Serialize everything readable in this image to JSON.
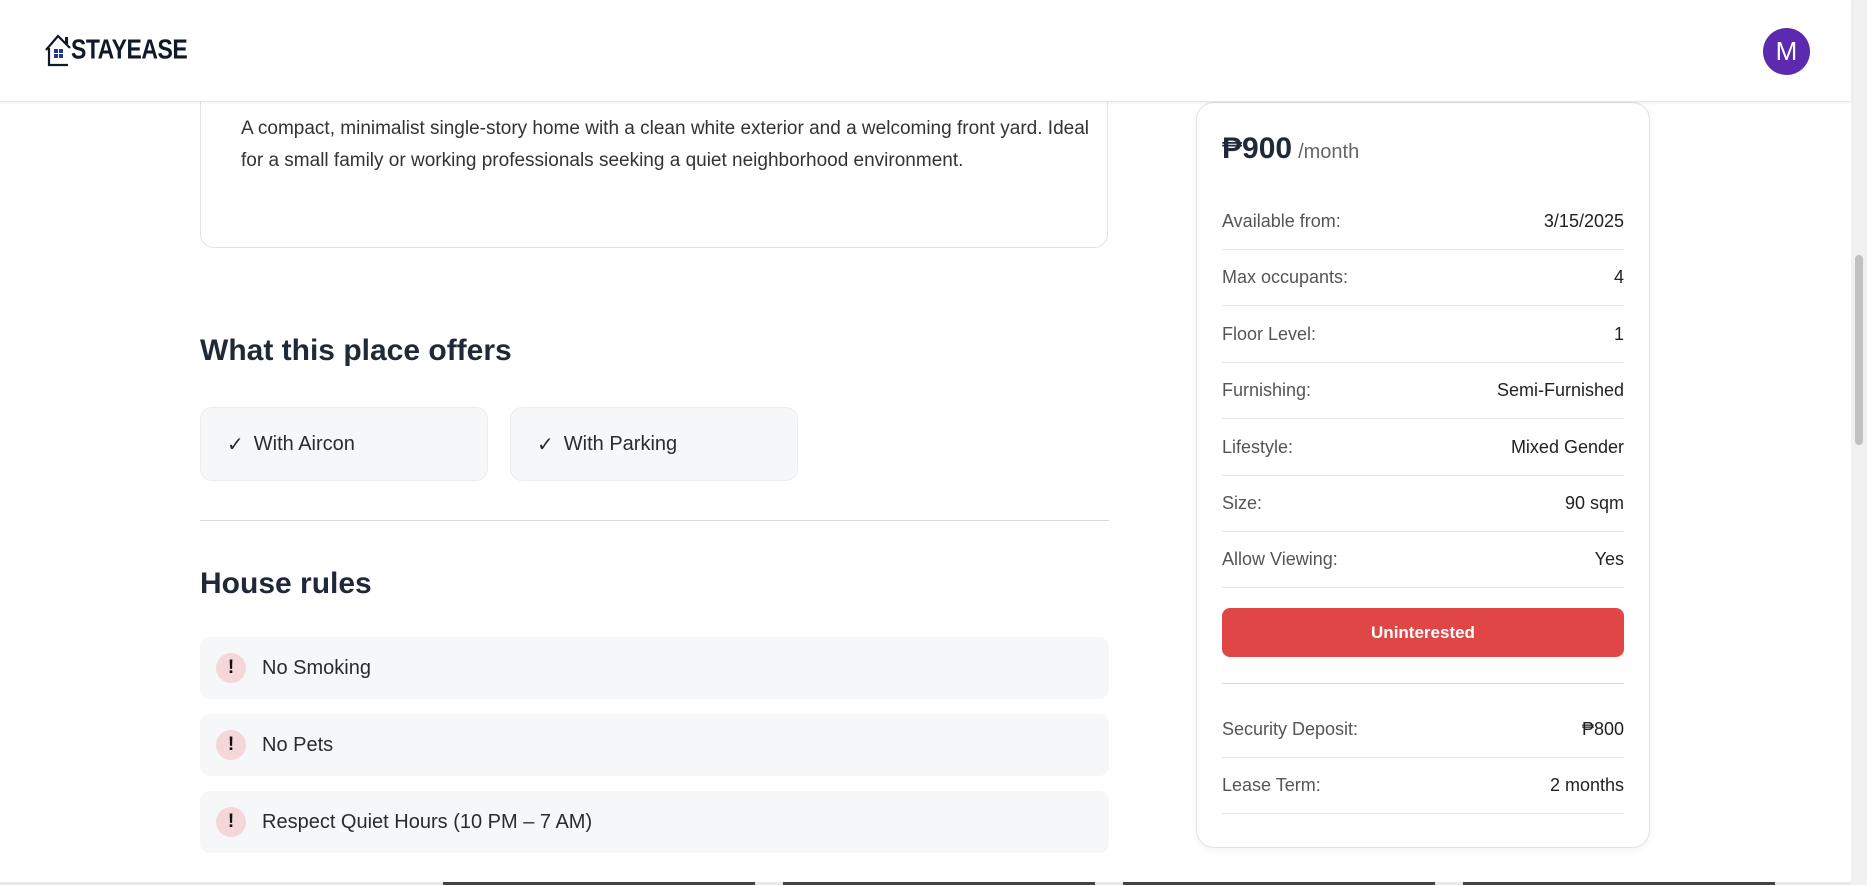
{
  "header": {
    "logo_text": "STAYEASE",
    "avatar_initial": "M"
  },
  "description": {
    "text": "A compact, minimalist single-story home with a clean white exterior and a welcoming front yard. Ideal for a small family or working professionals seeking a quiet neighborhood environment."
  },
  "amenities": {
    "title": "What this place offers",
    "check_glyph": "✓",
    "items": [
      "With Aircon",
      "With Parking"
    ]
  },
  "house_rules": {
    "title": "House rules",
    "icon_glyph": "!",
    "items": [
      "No Smoking",
      "No Pets",
      "Respect Quiet Hours (10 PM – 7 AM)"
    ]
  },
  "sidebar": {
    "price": "₱900",
    "price_unit": "/month",
    "details": [
      {
        "label": "Available from:",
        "value": "3/15/2025"
      },
      {
        "label": "Max occupants:",
        "value": "4"
      },
      {
        "label": "Floor Level:",
        "value": "1"
      },
      {
        "label": "Furnishing:",
        "value": "Semi-Furnished"
      },
      {
        "label": "Lifestyle:",
        "value": "Mixed Gender"
      },
      {
        "label": "Size:",
        "value": "90 sqm"
      },
      {
        "label": "Allow Viewing:",
        "value": "Yes"
      }
    ],
    "action_button": "Uninterested",
    "action_color": "#e14646",
    "extra": [
      {
        "label": "Security Deposit:",
        "value": "₱800"
      },
      {
        "label": "Lease Term:",
        "value": "2 months"
      }
    ]
  },
  "colors": {
    "avatar_bg": "#5b2aae",
    "rule_icon_bg": "#f5d6d9"
  }
}
